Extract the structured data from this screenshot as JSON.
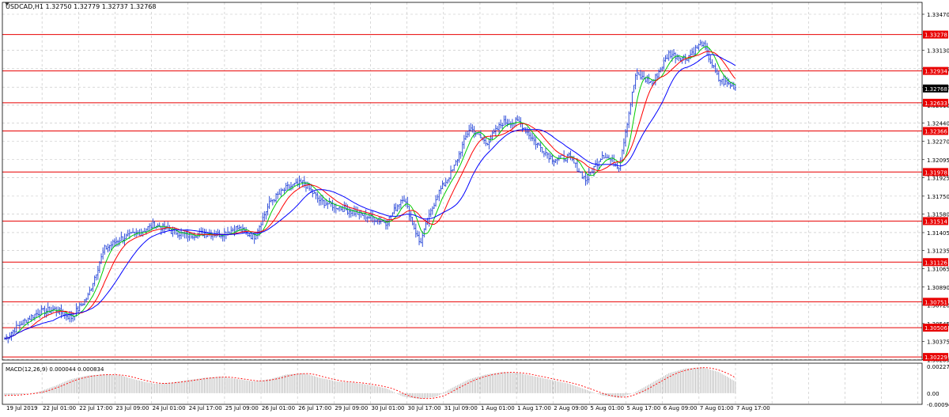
{
  "header": {
    "symbol_line": "USDCAD,H1  1.32750 1.32779 1.32737 1.32768",
    "macd_label": "MACD(12,26,9) 0.000044 0.000834"
  },
  "colors": {
    "background": "#ffffff",
    "grid": "#c0c0c0",
    "candles": "#1e3fd6",
    "ma_fast": "#00cc00",
    "ma_mid": "#ff0000",
    "ma_slow": "#0000ff",
    "level_line": "#e80000",
    "macd_hist": "#b0b0b0",
    "macd_signal": "#ff0000"
  },
  "chart_data": {
    "type": "line",
    "title": "USDCAD,H1",
    "ylim": [
      1.302,
      1.335
    ],
    "price_ticks": [
      "1.33470",
      "1.33130",
      "1.32955",
      "1.32780",
      "1.32610",
      "1.32440",
      "1.32270",
      "1.32095",
      "1.31925",
      "1.31750",
      "1.31580",
      "1.31405",
      "1.31235",
      "1.31065",
      "1.30890",
      "1.30720",
      "1.30545",
      "1.30375",
      "1.30205"
    ],
    "current_price": "1.32768",
    "levels": [
      "1.33278",
      "1.32934",
      "1.32633",
      "1.32366",
      "1.31978",
      "1.31514",
      "1.31126",
      "1.30751",
      "1.30506",
      "1.30229"
    ],
    "x_ticks": [
      "19 Jul 2019",
      "22 Jul 01:00",
      "22 Jul 17:00",
      "23 Jul 09:00",
      "24 Jul 01:00",
      "24 Jul 17:00",
      "25 Jul 09:00",
      "26 Jul 01:00",
      "26 Jul 17:00",
      "29 Jul 09:00",
      "30 Jul 01:00",
      "30 Jul 17:00",
      "31 Jul 09:00",
      "1 Aug 01:00",
      "1 Aug 17:00",
      "2 Aug 09:00",
      "5 Aug 01:00",
      "5 Aug 17:00",
      "6 Aug 09:00",
      "7 Aug 01:00",
      "7 Aug 17:00"
    ],
    "close_series": [
      1.304,
      1.3055,
      1.3065,
      1.3068,
      1.306,
      1.308,
      1.3125,
      1.3135,
      1.314,
      1.3148,
      1.3142,
      1.3138,
      1.314,
      1.3139,
      1.3145,
      1.3136,
      1.317,
      1.3183,
      1.3188,
      1.317,
      1.3165,
      1.316,
      1.3155,
      1.315,
      1.3175,
      1.313,
      1.3175,
      1.32,
      1.324,
      1.3225,
      1.3245,
      1.3245,
      1.3225,
      1.321,
      1.3212,
      1.319,
      1.3215,
      1.3203,
      1.329,
      1.3282,
      1.331,
      1.3305,
      1.332,
      1.3285,
      1.3278
    ],
    "macd_ticks": [
      "0.002278",
      "0.00",
      "-0.000947"
    ],
    "macd_values": [
      -0.0002,
      -0.0001,
      0.0001,
      0.0006,
      0.0012,
      0.0015,
      0.0016,
      0.0015,
      0.0011,
      0.0008,
      0.0009,
      0.0011,
      0.0013,
      0.0014,
      0.0012,
      0.001,
      0.0012,
      0.0016,
      0.0017,
      0.0013,
      0.001,
      0.0009,
      0.0007,
      0.0004,
      -0.0003,
      -0.0005,
      -0.0003,
      0.0005,
      0.0012,
      0.0016,
      0.0018,
      0.0017,
      0.0014,
      0.0011,
      0.0008,
      0.0003,
      -0.0002,
      -0.0004,
      0.0001,
      0.0009,
      0.0017,
      0.0021,
      0.0022,
      0.0018,
      0.001
    ]
  }
}
